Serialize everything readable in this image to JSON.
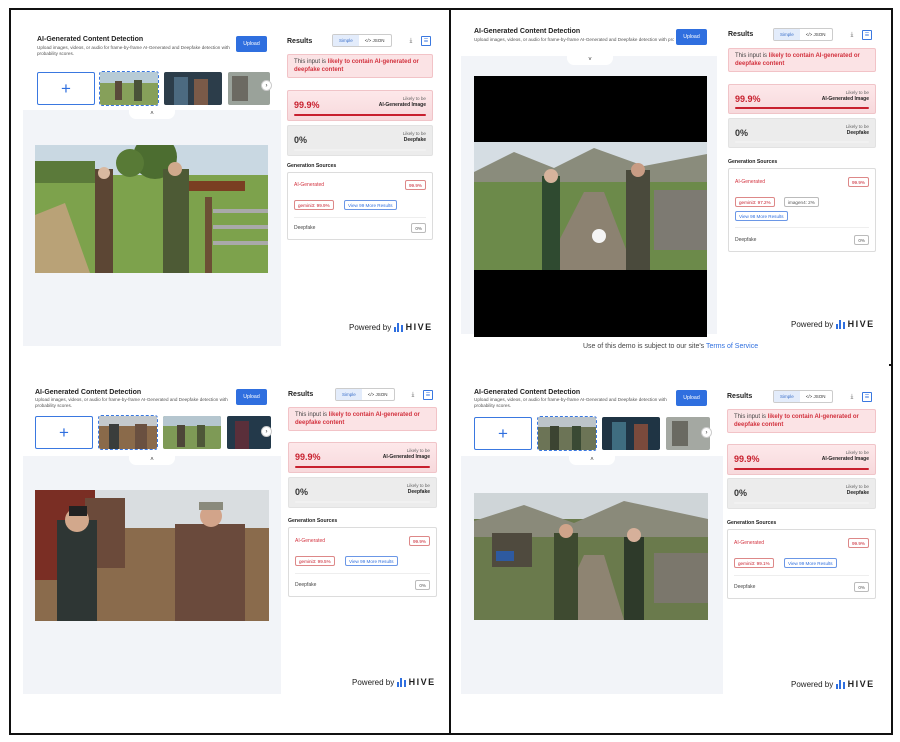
{
  "app": {
    "title": "AI-Generated Content Detection",
    "description": "Upload images, videos, or audio for frame-by-frame AI-Generated and Deepfake detection with probability scores.",
    "upload_label": "Upload",
    "add_label": "+",
    "next_label": "›",
    "collapse_label": "˄",
    "expand_label": "˅"
  },
  "results": {
    "title": "Results",
    "simple_label": "Simple",
    "json_label": "</> JSON",
    "download_icon": "download-icon",
    "layout_icon": "layout-icon",
    "verdict_prefix": "This input is ",
    "verdict_emphasis": "likely to contain AI-generated or deepfake content",
    "likely_to_be": "Likely to be",
    "ai_label": "AI-Generated Image",
    "deepfake_label": "Deepfake",
    "deepfake_score": "0%",
    "generation_sources": "Generation Sources",
    "ai_row_label": "AI-Generated",
    "deepfake_row_label": "Deepfake",
    "accent": "#d2323e",
    "brand_blue": "#2f6fdf"
  },
  "footer": {
    "powered_by": "Powered by",
    "brand": "HIVE",
    "tos_prefix": "Use of this demo is subject to our site's ",
    "tos_link": "Terms of Service"
  },
  "panels": [
    {
      "ai_score": "99.9%",
      "ai_fraction": 0.999,
      "ai_badge": "99.9%",
      "source_1": "gemini3: 99.9%",
      "source_2": "",
      "more_results": "View 99 More Results",
      "deepfake_badge": "0%"
    },
    {
      "ai_score": "99.9%",
      "ai_fraction": 0.999,
      "ai_badge": "99.9%",
      "source_1": "gemini3: 97.2%",
      "source_2": "imagen4: 2%",
      "more_results": "View 98 More Results",
      "deepfake_badge": "0%"
    },
    {
      "ai_score": "99.9%",
      "ai_fraction": 0.999,
      "ai_badge": "99.9%",
      "source_1": "gemini3: 99.5%",
      "source_2": "",
      "more_results": "View 99 More Results",
      "deepfake_badge": "0%"
    },
    {
      "ai_score": "99.9%",
      "ai_fraction": 0.999,
      "ai_badge": "99.9%",
      "source_1": "gemini3: 99.1%",
      "source_2": "",
      "more_results": "View 99 More Results",
      "deepfake_badge": "0%"
    }
  ]
}
